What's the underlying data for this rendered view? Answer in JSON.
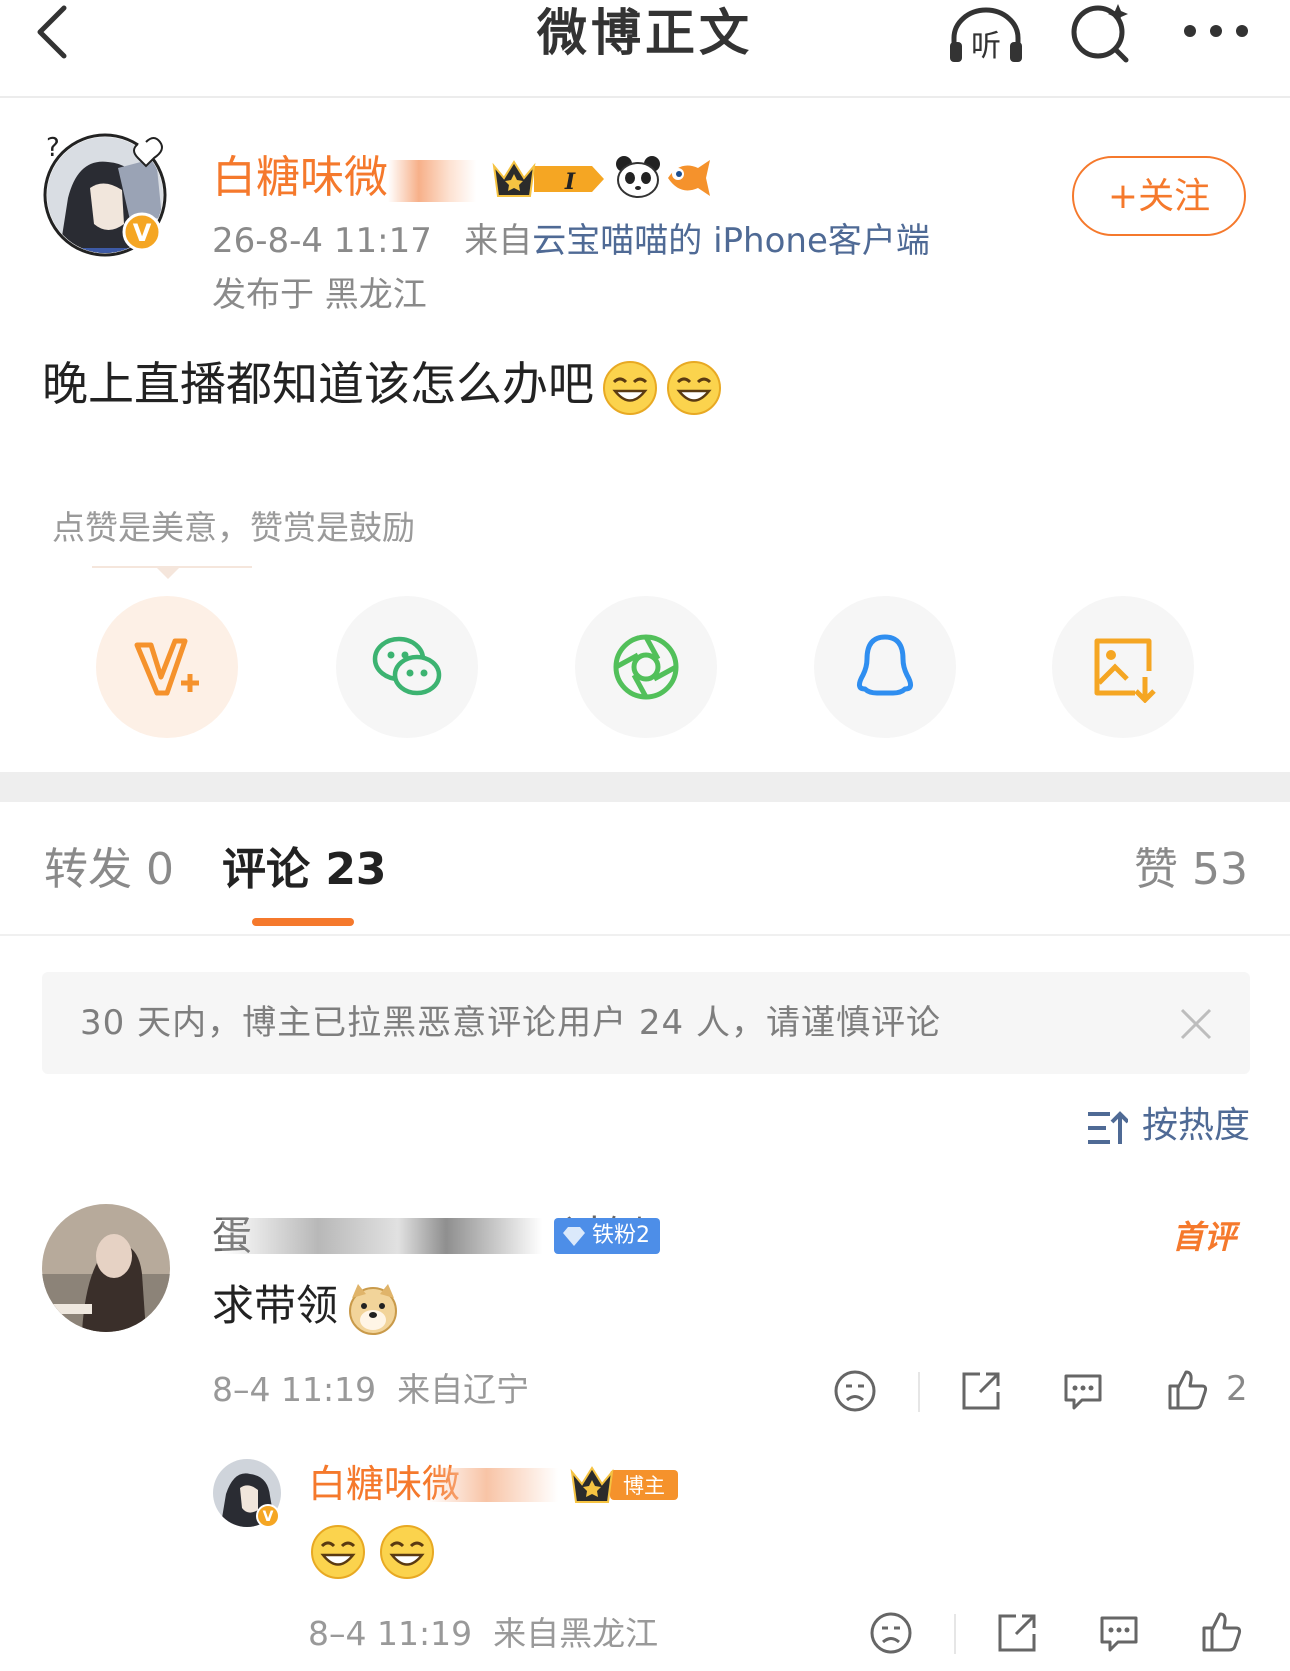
{
  "header": {
    "title": "微博正文",
    "listen_label": "听"
  },
  "post": {
    "author": "白糖味微",
    "badge_level": "I",
    "follow_label": "+关注",
    "time": "26-8-4 11:17",
    "source_prefix": "来自",
    "source_name": "云宝喵喵的 iPhone客户端",
    "location": "发布于 黑龙江",
    "text": "晚上直播都知道该怎么办吧",
    "reward_tip": "点赞是美意，赞赏是鼓励"
  },
  "share": [
    {
      "name": "vip-reward",
      "icon": "v-plus-icon"
    },
    {
      "name": "wechat",
      "icon": "wechat-icon"
    },
    {
      "name": "moments",
      "icon": "moments-icon"
    },
    {
      "name": "qq",
      "icon": "qq-icon"
    },
    {
      "name": "save-image",
      "icon": "image-download-icon"
    }
  ],
  "tabs": {
    "repost": "转发 0",
    "comment": "评论 23",
    "like": "赞 53"
  },
  "notice": {
    "text": "30 天内，博主已拉黑恶意评论用户 24 人，请谨慎评论"
  },
  "sort": {
    "label": "按热度"
  },
  "comments": [
    {
      "name": "蛋",
      "name_suffix": "过倒",
      "fan_badge": "铁粉2",
      "tag": "首评",
      "text": "求带领",
      "time": "8–4 11:19",
      "location": "来自辽宁",
      "like_count": "2",
      "reply": {
        "name": "白糖味微",
        "badge": "博主",
        "time": "8–4 11:19",
        "location": "来自黑龙江"
      }
    }
  ],
  "colors": {
    "accent": "#f5792c",
    "link": "#4f6a95",
    "fan_badge": "#4d8ee8"
  }
}
